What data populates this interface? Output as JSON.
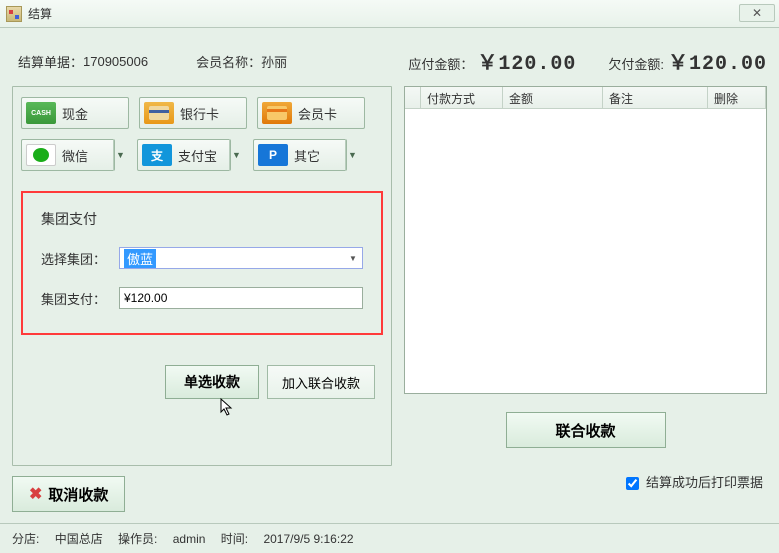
{
  "window": {
    "title": "结算"
  },
  "info": {
    "order_label": "结算单据：",
    "order_value": "170905006",
    "member_label": "会员名称：",
    "member_value": "孙丽",
    "due_label": "应付金额：",
    "due_value": "￥120.00",
    "owed_label": "欠付金额:",
    "owed_value": "￥120.00"
  },
  "payments": {
    "cash": "现金",
    "bank": "银行卡",
    "member": "会员卡",
    "wechat": "微信",
    "alipay": "支付宝",
    "other": "其它"
  },
  "group": {
    "title": "集团支付",
    "select_label": "选择集团：",
    "select_value": "傲蓝",
    "amount_label": "集团支付：",
    "amount_value": "¥120.00"
  },
  "buttons": {
    "single": "单选收款",
    "add_combined": "加入联合收款",
    "cancel": "取消收款",
    "combined": "联合收款"
  },
  "table": {
    "col_method": "付款方式",
    "col_amount": "金额",
    "col_note": "备注",
    "col_delete": "删除"
  },
  "checkbox": {
    "print_label": "结算成功后打印票据",
    "checked": true
  },
  "status": {
    "branch_label": "分店:",
    "branch_value": "中国总店",
    "operator_label": "操作员:",
    "operator_value": "admin",
    "time_label": "时间:",
    "time_value": "2017/9/5 9:16:22"
  }
}
